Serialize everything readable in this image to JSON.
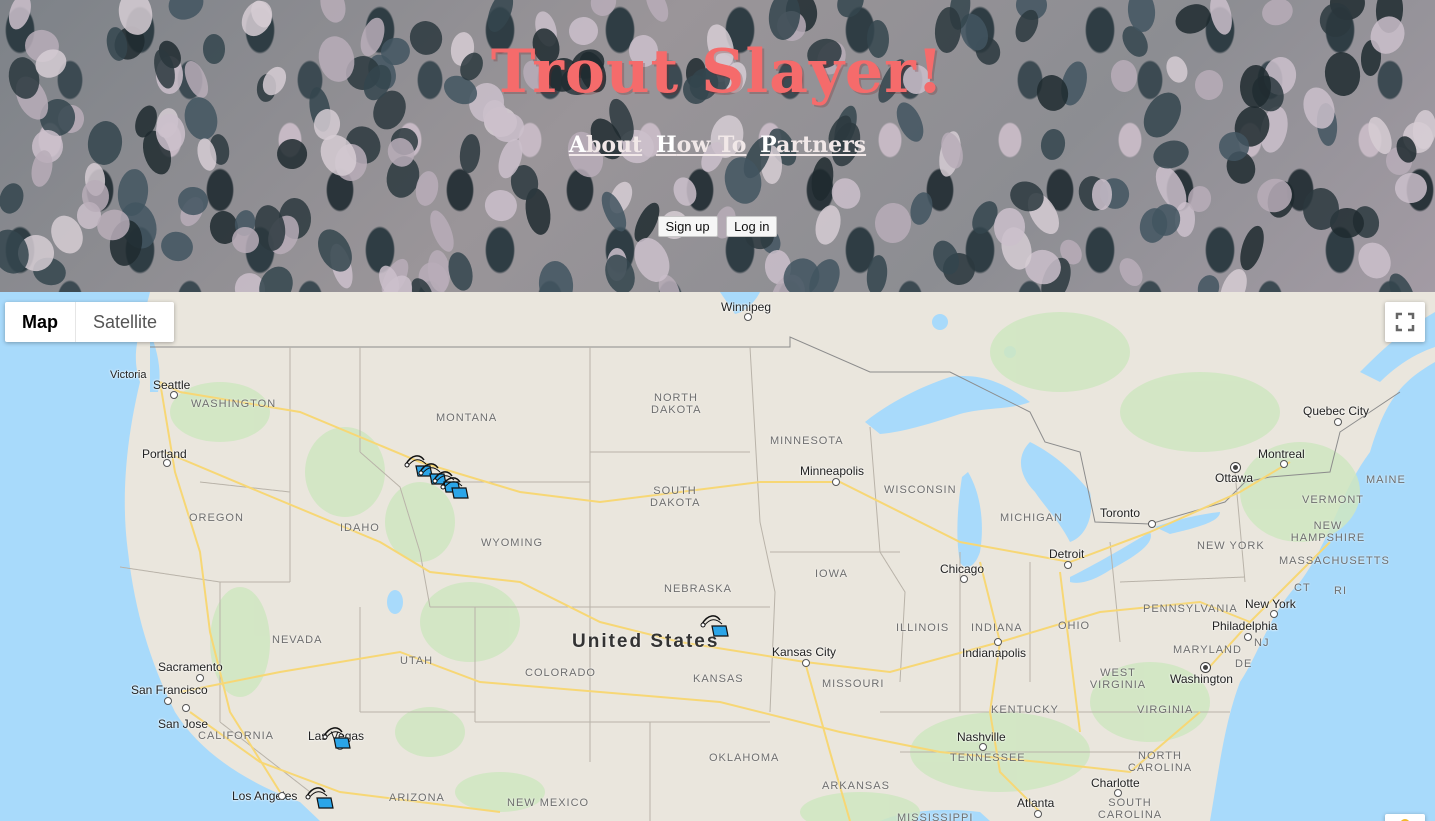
{
  "site": {
    "title": "Trout Slayer!",
    "nav": [
      {
        "first": "A",
        "rest": "bout"
      },
      {
        "first": "H",
        "rest": "ow To"
      },
      {
        "first": "P",
        "rest": "artners"
      }
    ],
    "signup_label": "Sign up",
    "login_label": "Log in"
  },
  "map": {
    "type_controls": {
      "map": "Map",
      "satellite": "Satellite"
    },
    "active_type": "Map",
    "icons": {
      "fullscreen": "fullscreen-icon",
      "pegman": "pegman-icon",
      "marker": "fly-rod-marker-icon"
    },
    "country": "United States",
    "states": [
      "WASHINGTON",
      "MONTANA",
      "NORTH DAKOTA",
      "MINNESOTA",
      "WISCONSIN",
      "MICHIGAN",
      "OREGON",
      "IDAHO",
      "SOUTH DAKOTA",
      "WYOMING",
      "NEBRASKA",
      "IOWA",
      "NEVADA",
      "UTAH",
      "COLORADO",
      "KANSAS",
      "MISSOURI",
      "ILLINOIS",
      "INDIANA",
      "OHIO",
      "PENNSYLVANIA",
      "NEW YORK",
      "VERMONT",
      "NEW HAMPSHIRE",
      "MAINE",
      "MASSACHUSETTS",
      "CT",
      "RI",
      "NJ",
      "DE",
      "MARYLAND",
      "WEST VIRGINIA",
      "VIRGINIA",
      "KENTUCKY",
      "TENNESSEE",
      "NORTH CAROLINA",
      "SOUTH CAROLINA",
      "CALIFORNIA",
      "ARIZONA",
      "NEW MEXICO",
      "OKLAHOMA",
      "ARKANSAS",
      "MISSISSIPPI"
    ],
    "cities": [
      "Winnipeg",
      "Victoria",
      "Seattle",
      "Portland",
      "Minneapolis",
      "Quebec City",
      "Montreal",
      "Ottawa",
      "Toronto",
      "Detroit",
      "Chicago",
      "Indianapolis",
      "Kansas City",
      "New York",
      "Philadelphia",
      "Washington",
      "Nashville",
      "Charlotte",
      "Atlanta",
      "Sacramento",
      "San Francisco",
      "San Jose",
      "Las Vegas",
      "Los Angeles"
    ]
  },
  "colors": {
    "title": "#f56b6b",
    "water": "#a8dafb",
    "land": "#eae6dd",
    "marker": "#2ba5e8"
  }
}
